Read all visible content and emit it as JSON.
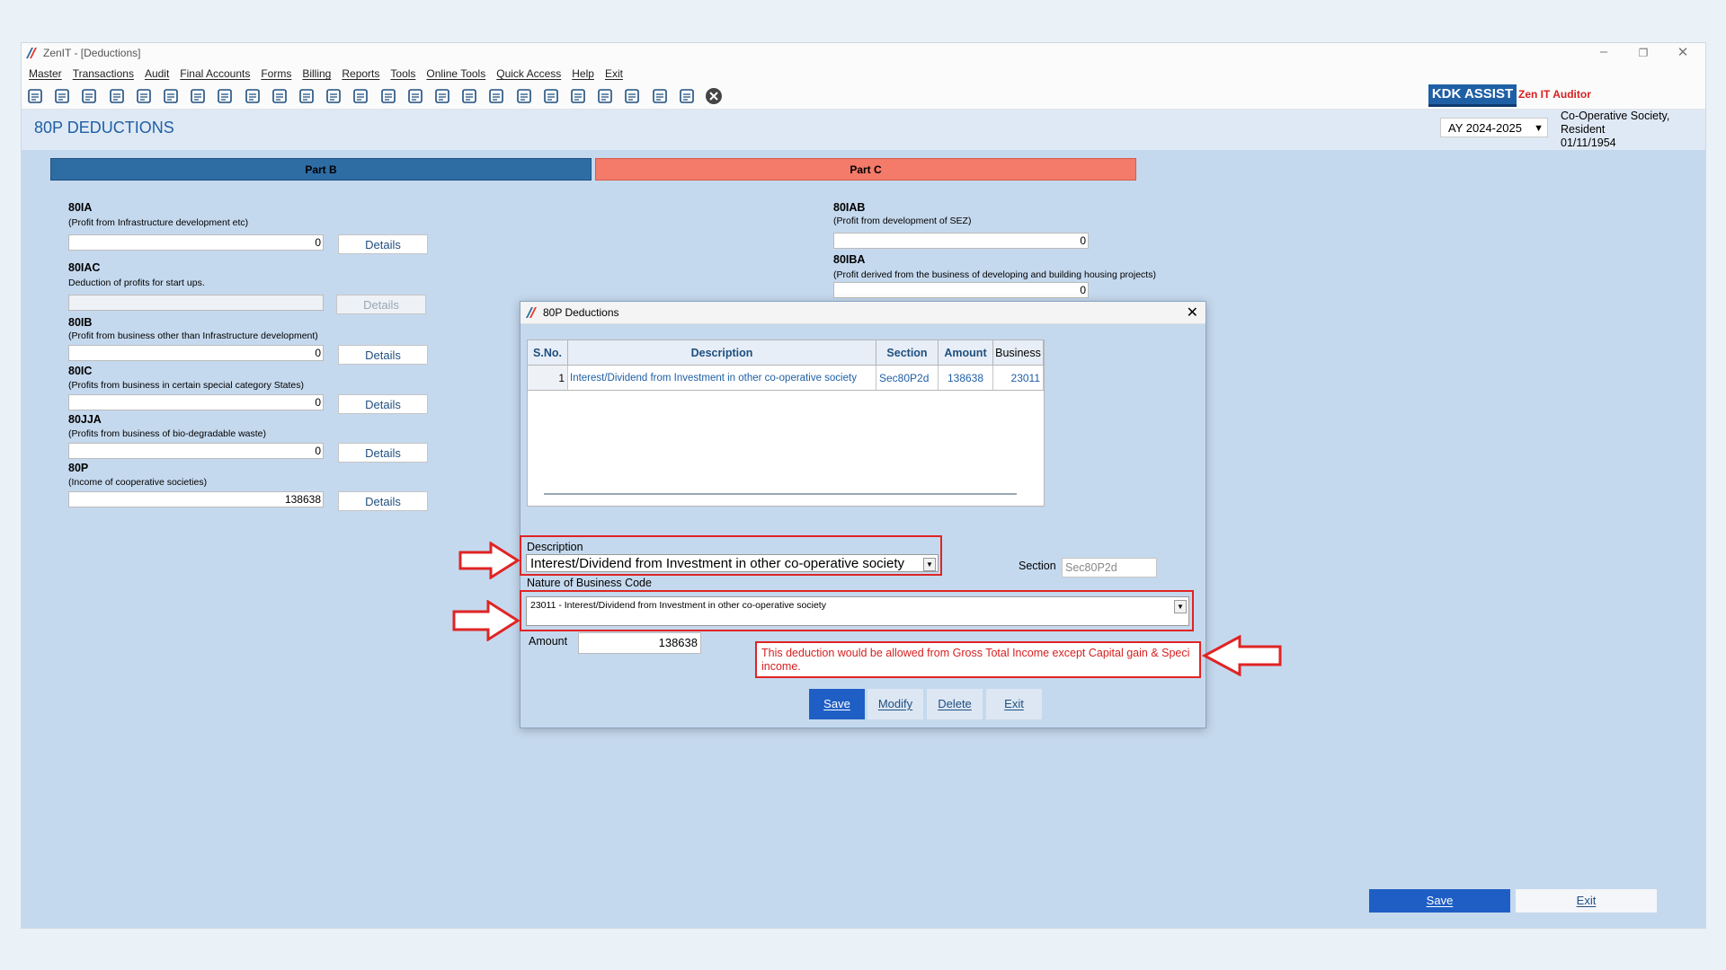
{
  "window": {
    "title": "ZenIT - [Deductions]"
  },
  "menu": [
    "Master",
    "Transactions",
    "Audit",
    "Final Accounts",
    "Forms",
    "Billing",
    "Reports",
    "Tools",
    "Online Tools",
    "Quick Access",
    "Help",
    "Exit"
  ],
  "toolbar": {
    "icons": [
      "book-icon",
      "home-icon",
      "building-icon",
      "bar-chart-icon",
      "gift-icon",
      "users-icon",
      "tools-icon",
      "filter-icon",
      "tax-icon",
      "rewind-icon",
      "calculator-icon",
      "pie-icon",
      "pay-icon",
      "tablet-icon",
      "info-icon",
      "report-icon",
      "export-icon",
      "calendar-icon",
      "refresh-icon",
      "sync-icon",
      "card-icon",
      "contacts-icon",
      "bank-icon",
      "id-icon",
      "form-icon",
      "close-circle-icon"
    ],
    "brand": "KDK ASSIST",
    "product": "Zen IT Auditor"
  },
  "header": {
    "title": "80P DEDUCTIONS",
    "ay": "AY 2024-2025",
    "entity_line1": "Co-Operative Society,",
    "entity_line2": "Resident",
    "entity_line3": "01/11/1954"
  },
  "tabs": {
    "part_b": "Part B",
    "part_c": "Part C"
  },
  "details_label": "Details",
  "sections_left": [
    {
      "code": "80IA",
      "desc": "(Profit from Infrastructure development etc)",
      "value": "0"
    },
    {
      "code": "80IAC",
      "desc": "Deduction of profits for start ups.",
      "value": ""
    },
    {
      "code": "80IB",
      "desc": "(Profit from business other than Infrastructure development)",
      "value": "0"
    },
    {
      "code": "80IC",
      "desc": "(Profits from business in certain special category States)",
      "value": "0"
    },
    {
      "code": "80JJA",
      "desc": "(Profits from business of bio-degradable waste)",
      "value": "0"
    },
    {
      "code": "80P",
      "desc": "(Income of cooperative societies)",
      "value": "138638"
    }
  ],
  "sections_right": [
    {
      "code": "80IAB",
      "desc": "(Profit from development of SEZ)",
      "value": "0"
    },
    {
      "code": "80IBA",
      "desc": "(Profit derived from the business of developing and building housing projects)",
      "value": "0"
    }
  ],
  "dialog": {
    "title": "80P Deductions",
    "columns": [
      "S.No.",
      "Description",
      "Section",
      "Amount",
      "Business"
    ],
    "rows": [
      {
        "sno": "1",
        "description": "Interest/Dividend from Investment in other co-operative society",
        "section": "Sec80P2d",
        "amount": "138638",
        "business": "23011"
      }
    ],
    "description_label": "Description",
    "description_value": "Interest/Dividend from Investment in other co-operative society",
    "section_label": "Section",
    "section_value": "Sec80P2d",
    "nature_label": "Nature of Business Code",
    "nature_value": "23011 - Interest/Dividend from Investment in other co-operative society",
    "amount_label": "Amount",
    "amount_value": "138638",
    "note": "This deduction would be allowed from Gross Total Income except Capital gain & Speci income.",
    "buttons": {
      "save": "Save",
      "modify": "Modify",
      "delete": "Delete",
      "exit": "Exit"
    }
  },
  "footer": {
    "save": "Save",
    "exit": "Exit"
  },
  "colors": {
    "accent": "#1f5fa5",
    "part_b": "#2e6da4",
    "part_c": "#f47a6a",
    "highlight": "#e02424",
    "background": "#c5d9ee"
  }
}
